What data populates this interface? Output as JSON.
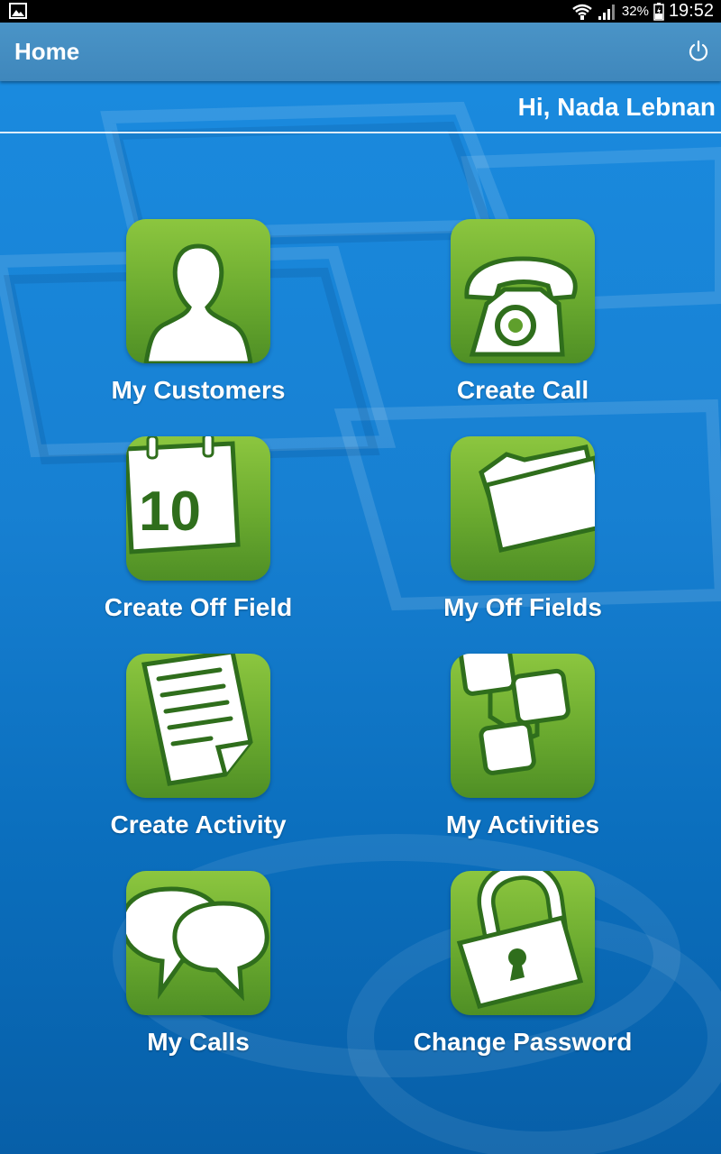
{
  "status_bar": {
    "battery_percent": "32%",
    "time": "19:52",
    "icons": [
      "gallery-notification-icon",
      "wifi-icon",
      "signal-icon",
      "battery-icon"
    ]
  },
  "action_bar": {
    "title": "Home",
    "power_icon": "power-icon"
  },
  "greeting": "Hi, Nada Lebnan",
  "tiles": [
    {
      "label": "My Customers",
      "icon": "person-icon"
    },
    {
      "label": "Create Call",
      "icon": "telephone-icon"
    },
    {
      "label": "Create Off Field",
      "icon": "calendar-icon"
    },
    {
      "label": "My Off Fields",
      "icon": "folder-icon"
    },
    {
      "label": "Create Activity",
      "icon": "document-icon"
    },
    {
      "label": "My Activities",
      "icon": "flowchart-icon"
    },
    {
      "label": "My Calls",
      "icon": "chat-bubbles-icon"
    },
    {
      "label": "Change Password",
      "icon": "padlock-icon"
    }
  ],
  "calendar_day": "10",
  "colors": {
    "tile_green_top": "#8cc63f",
    "tile_green_bottom": "#4f8f25",
    "action_bar": "#4590c3",
    "background": "#1780d2"
  }
}
